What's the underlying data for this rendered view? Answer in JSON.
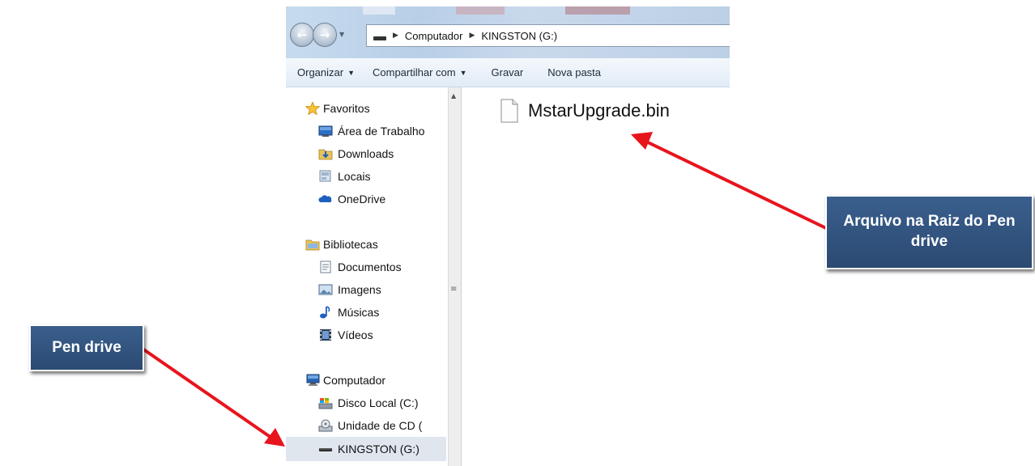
{
  "address_bar": {
    "crumbs": [
      "Computador",
      "KINGSTON (G:)"
    ]
  },
  "command_bar": {
    "items": [
      {
        "label": "Organizar",
        "has_dropdown": true
      },
      {
        "label": "Compartilhar com",
        "has_dropdown": true
      },
      {
        "label": "Gravar",
        "has_dropdown": false
      },
      {
        "label": "Nova pasta",
        "has_dropdown": false
      }
    ]
  },
  "sidebar": {
    "favorites": {
      "label": "Favoritos",
      "icon": "star-icon",
      "items": [
        {
          "label": "Área de Trabalho",
          "icon": "desktop-icon"
        },
        {
          "label": "Downloads",
          "icon": "downloads-icon"
        },
        {
          "label": "Locais",
          "icon": "recent-places-icon"
        },
        {
          "label": "OneDrive",
          "icon": "onedrive-icon"
        }
      ]
    },
    "libraries": {
      "label": "Bibliotecas",
      "icon": "libraries-icon",
      "items": [
        {
          "label": "Documentos",
          "icon": "documents-icon"
        },
        {
          "label": "Imagens",
          "icon": "pictures-icon"
        },
        {
          "label": "Músicas",
          "icon": "music-icon"
        },
        {
          "label": "Vídeos",
          "icon": "videos-icon"
        }
      ]
    },
    "computer": {
      "label": "Computador",
      "icon": "computer-icon",
      "items": [
        {
          "label": "Disco Local (C:)",
          "icon": "local-disk-icon"
        },
        {
          "label": "Unidade de CD (",
          "icon": "cd-drive-icon"
        },
        {
          "label": "KINGSTON (G:)",
          "icon": "usb-drive-icon",
          "selected": true
        }
      ]
    }
  },
  "content": {
    "files": [
      {
        "name": "MstarUpgrade.bin",
        "icon": "file-icon"
      }
    ]
  },
  "annotations": {
    "file_callout": "Arquivo na Raiz do Pen drive",
    "pen_callout": "Pen drive",
    "arrow_color": "#e8141c"
  },
  "colors": {
    "callout_bg": "#2f5179",
    "selected_bg": "#dfe6ee",
    "toolbar_bg": "#e1ebf6"
  }
}
